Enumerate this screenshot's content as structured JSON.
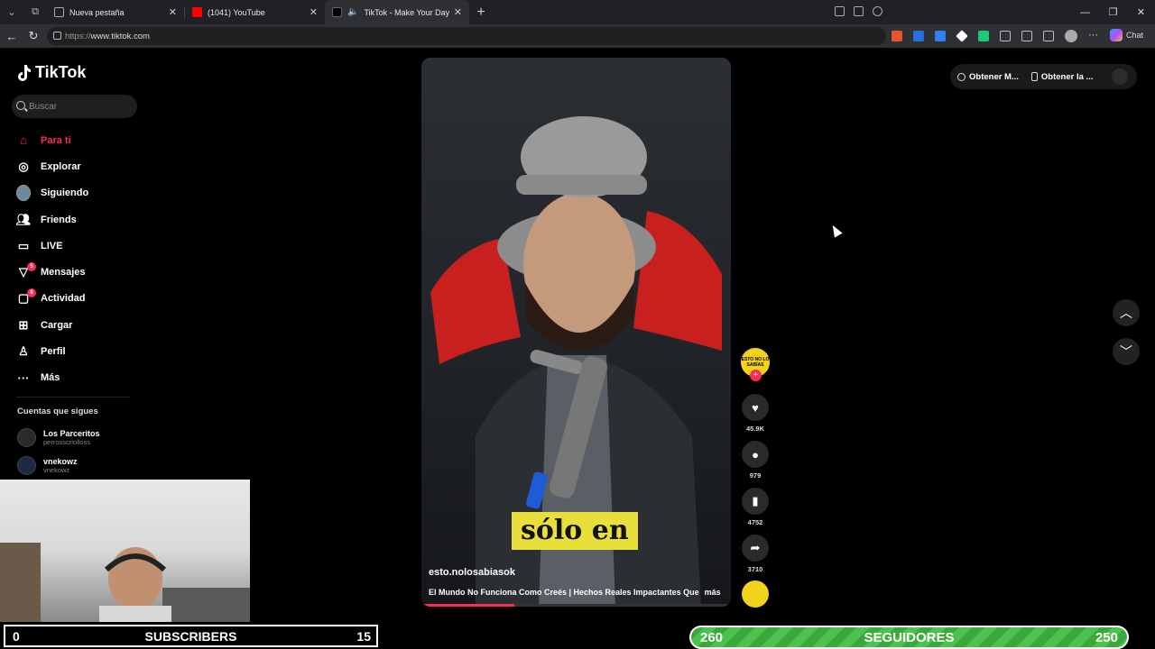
{
  "browser": {
    "tabs": [
      {
        "label": "Nueva pestaña"
      },
      {
        "label": "(1041) YouTube"
      },
      {
        "label": "TikTok - Make Your Day"
      }
    ],
    "url_proto": "https://",
    "url_host": "www.tiktok.com",
    "chat_label": "Chat"
  },
  "tiktok": {
    "logo": "TikTok",
    "search_placeholder": "Buscar",
    "nav": [
      {
        "label": "Para ti",
        "icon": "home-icon"
      },
      {
        "label": "Explorar",
        "icon": "compass-icon"
      },
      {
        "label": "Siguiendo",
        "icon": "following-avatar-icon"
      },
      {
        "label": "Friends",
        "icon": "friends-icon"
      },
      {
        "label": "LIVE",
        "icon": "live-icon"
      },
      {
        "label": "Mensajes",
        "icon": "messages-icon",
        "badge": "5"
      },
      {
        "label": "Actividad",
        "icon": "activity-icon",
        "badge": "8"
      },
      {
        "label": "Cargar",
        "icon": "upload-icon"
      },
      {
        "label": "Perfil",
        "icon": "profile-icon"
      },
      {
        "label": "Más",
        "icon": "more-icon"
      }
    ],
    "following_title": "Cuentas que sigues",
    "accounts": [
      {
        "name": "Los Parceritos",
        "handle": "perrosscriolloss"
      },
      {
        "name": "vnekowz",
        "handle": "vnekowz"
      }
    ],
    "top_buttons": {
      "coins": "Obtener M...",
      "app": "Obtener la ..."
    },
    "video": {
      "caption": "sólo en",
      "username": "esto.nolosabiasok",
      "description": "El Mundo No Funciona Como Creés | Hechos Reales Impactantes Que",
      "more": "más",
      "progress": 0.3
    },
    "actions": {
      "likes": "45.9K",
      "comments": "979",
      "saves": "4752",
      "shares": "3710",
      "avatar_text": "ESTO NO LO SABÍAS"
    }
  },
  "overlay": {
    "subs_left": "0",
    "subs_label": "SUBSCRIBERS",
    "subs_right": "15",
    "followers_left": "260",
    "followers_label": "SEGUIDORES",
    "followers_right": "250"
  }
}
